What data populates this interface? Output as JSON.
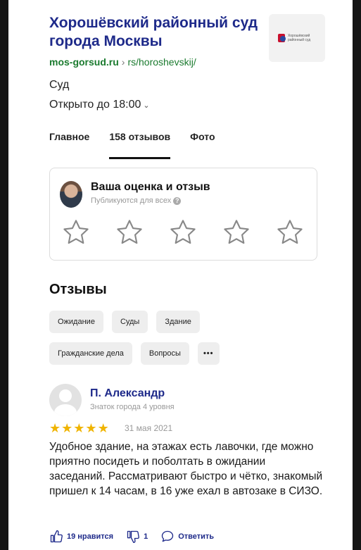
{
  "org": {
    "title": "Хорошёвский районный суд города Москвы",
    "url_domain": "mos-gorsud.ru",
    "url_path": "rs/horoshevskij/",
    "category": "Суд",
    "hours": "Открыто до 18:00",
    "logo_text": "Хорошёвский районный суд"
  },
  "tabs": [
    {
      "label": "Главное"
    },
    {
      "label": "158 отзывов",
      "active": true
    },
    {
      "label": "Фото"
    }
  ],
  "rate_card": {
    "title": "Ваша оценка и отзыв",
    "subtitle": "Публикуются для всех",
    "stars_total": 5,
    "stars_selected": 0
  },
  "reviews_section": {
    "title": "Отзывы",
    "chips_row1": [
      "Ожидание",
      "Суды",
      "Здание"
    ],
    "chips_row2": [
      "Гражданские дела",
      "Вопросы"
    ],
    "more_label": "•••"
  },
  "review": {
    "author": "П. Александр",
    "level": "Знаток города 4 уровня",
    "rating": 5,
    "date": "31 мая 2021",
    "text": "Удобное здание, на этажах есть лавочки, где можно приятно посидеть и поболтать в ожидании заседаний. Рассматривают быстро и чётко, знакомый пришел к 14 часам, в 16 уже ехал в автозаке в СИЗО.",
    "likes": "19 нравится",
    "dislikes": "1",
    "reply": "Ответить"
  },
  "colors": {
    "title_blue": "#1e2a8a",
    "url_green": "#1a7a2e",
    "star_gold": "#f0b400"
  }
}
